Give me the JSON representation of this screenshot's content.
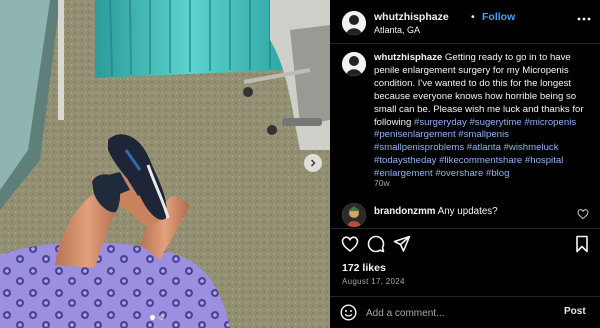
{
  "post": {
    "username": "whutzhisphaze",
    "separator": "•",
    "follow_label": "Follow",
    "location": "Atlanta, GA",
    "caption_text": "Getting ready to go in to have penile enlargement surgery for my Micropenis condition. I've wanted to do this for the longest because everyone knows how horrible being so small can be. Please wish me luck and thanks for following",
    "hashtags": "#surgeryday #sugerytime #micropenis #penisenlargement #smallpenis #smallpenisproblems #atlanta #wishmeluck #todaystheday #likecommentshare #hospital #enlargement #overshare #blog",
    "age": "70w",
    "comment": {
      "username": "brandonzmm",
      "text": "Any updates?"
    },
    "likes": "172 likes",
    "date": "August 17, 2024",
    "add_comment_placeholder": "Add a comment...",
    "post_label": "Post"
  },
  "media": {
    "slide_count": 2,
    "active_slide": 1
  },
  "colors": {
    "follow": "#4a9ff5",
    "hashtag": "#8fb4f4",
    "background": "#000000",
    "muted": "#a8a8a8"
  },
  "icons": [
    "more-options-icon",
    "like-heart-icon",
    "comment-icon",
    "share-icon",
    "save-bookmark-icon",
    "comment-like-heart-icon",
    "emoji-icon",
    "next-slide-arrow-icon"
  ]
}
